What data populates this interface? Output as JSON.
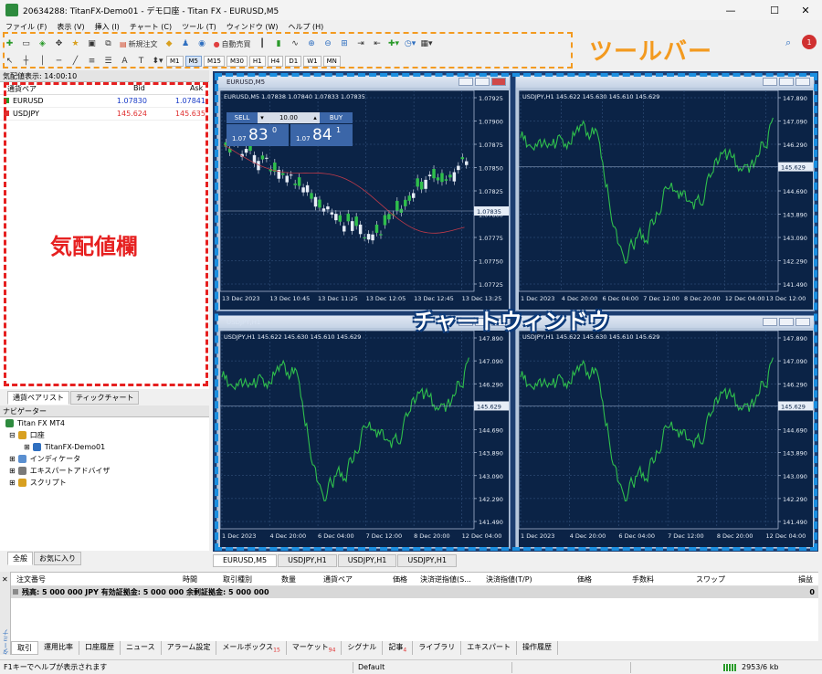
{
  "window": {
    "title": "20634288: TitanFX-Demo01 - デモ口座 - Titan FX - EURUSD,M5",
    "minimize": "—",
    "maximize": "☐",
    "close": "✕"
  },
  "menu": [
    "ファイル (F)",
    "表示 (V)",
    "挿入 (I)",
    "チャート (C)",
    "ツール (T)",
    "ウィンドウ (W)",
    "ヘルプ (H)"
  ],
  "toolbar": {
    "new_order": "新規注文",
    "auto_trading": "自動売買",
    "timeframes": [
      "M1",
      "M5",
      "M15",
      "M30",
      "H1",
      "H4",
      "D1",
      "W1",
      "MN"
    ],
    "selected_timeframe": "M5",
    "annotation_label": "ツールバー",
    "notification_count": "1"
  },
  "market_watch": {
    "header": "気配値表示: 14:00:10",
    "columns": {
      "symbol": "通貨ペア",
      "bid": "Bid",
      "ask": "Ask"
    },
    "rows": [
      {
        "symbol": "EURUSD",
        "bid": "1.07830",
        "ask": "1.07841",
        "color": "#1a3cc8"
      },
      {
        "symbol": "USDJPY",
        "bid": "145.624",
        "ask": "145.635",
        "color": "#e03030"
      }
    ],
    "tabs": [
      "通貨ペアリスト",
      "ティックチャート"
    ],
    "annotation_label": "気配値欄"
  },
  "navigator": {
    "header": "ナビゲーター",
    "items": [
      {
        "label": "Titan FX MT4",
        "level": 0
      },
      {
        "label": "口座",
        "level": 1
      },
      {
        "label": "TitanFX-Demo01",
        "level": 2
      },
      {
        "label": "インディケータ",
        "level": 1
      },
      {
        "label": "エキスパートアドバイザ",
        "level": 1
      },
      {
        "label": "スクリプト",
        "level": 1
      }
    ],
    "tabs": [
      "全般",
      "お気に入り"
    ]
  },
  "charts": {
    "annotation_label": "チャートウィンドウ",
    "windows": [
      {
        "title": "EURUSD,M5",
        "info": "EURUSD,M5  1.07838 1.07840 1.07833 1.07835",
        "price_labels": [
          "1.07925",
          "1.07900",
          "1.07875",
          "1.07850",
          "1.07825",
          "1.07800",
          "1.07775",
          "1.07750",
          "1.07725"
        ],
        "current_price": "1.07835",
        "time_labels": [
          "13 Dec 2023",
          "13 Dec 10:45",
          "13 Dec 11:25",
          "13 Dec 12:05",
          "13 Dec 12:45",
          "13 Dec 13:25"
        ],
        "one_click": {
          "sell": "SELL",
          "buy": "BUY",
          "lot": "10.00",
          "sell_big": "83",
          "sell_small": "1.07",
          "sell_sup": "0",
          "buy_big": "84",
          "buy_small": "1.07",
          "buy_sup": "1"
        }
      },
      {
        "title": "USDJPY,H1",
        "info": "USDJPY,H1  145.622 145.630 145.610 145.629",
        "price_labels": [
          "147.890",
          "147.090",
          "146.290",
          "145.629",
          "144.690",
          "143.890",
          "143.090",
          "142.290",
          "141.490"
        ],
        "current_price": "145.629",
        "time_labels": [
          "1 Dec 2023",
          "4 Dec 20:00",
          "6 Dec 04:00",
          "7 Dec 12:00",
          "8 Dec 20:00",
          "12 Dec 04:00",
          "13 Dec 12:00"
        ]
      },
      {
        "title": "USDJPY,H1",
        "info": "USDJPY,H1  145.622 145.630 145.610 145.629",
        "price_labels": [
          "147.890",
          "147.090",
          "146.290",
          "145.629",
          "144.690",
          "143.890",
          "143.090",
          "142.290",
          "141.490"
        ],
        "current_price": "145.629",
        "time_labels": [
          "1 Dec 2023",
          "4 Dec 20:00",
          "6 Dec 04:00",
          "7 Dec 12:00",
          "8 Dec 20:00",
          "12 Dec 04:00"
        ]
      },
      {
        "title": "USDJPY,H1",
        "info": "USDJPY,H1  145.622 145.630 145.610 145.629",
        "price_labels": [
          "147.890",
          "147.090",
          "146.290",
          "145.629",
          "144.690",
          "143.890",
          "143.090",
          "142.290",
          "141.490"
        ],
        "current_price": "145.629",
        "time_labels": [
          "1 Dec 2023",
          "4 Dec 20:00",
          "6 Dec 04:00",
          "7 Dec 12:00",
          "8 Dec 20:00",
          "12 Dec 04:00"
        ]
      }
    ],
    "tabs": [
      "EURUSD,M5",
      "USDJPY,H1",
      "USDJPY,H1",
      "USDJPY,H1"
    ]
  },
  "terminal": {
    "vertical_label": "ターミナル",
    "columns": [
      "注文番号",
      "時間",
      "取引種別",
      "数量",
      "通貨ペア",
      "価格",
      "決済逆指値(S...",
      "決済指値(T/P)",
      "価格",
      "手数料",
      "スワップ",
      "損益"
    ],
    "balance_line": "残高: 5 000 000 JPY  有効証拠金: 5 000 000  余剰証拠金: 5 000 000",
    "balance_profit": "0",
    "tabs": [
      {
        "label": "取引",
        "count": ""
      },
      {
        "label": "運用比率",
        "count": ""
      },
      {
        "label": "口座履歴",
        "count": ""
      },
      {
        "label": "ニュース",
        "count": ""
      },
      {
        "label": "アラーム設定",
        "count": ""
      },
      {
        "label": "メールボックス",
        "count": "15"
      },
      {
        "label": "マーケット",
        "count": "94"
      },
      {
        "label": "シグナル",
        "count": ""
      },
      {
        "label": "記事",
        "count": "4"
      },
      {
        "label": "ライブラリ",
        "count": ""
      },
      {
        "label": "エキスパート",
        "count": ""
      },
      {
        "label": "操作履歴",
        "count": ""
      }
    ]
  },
  "status": {
    "help": "F1キーでヘルプが表示されます",
    "profile": "Default",
    "traffic": "2953/6 kb"
  }
}
